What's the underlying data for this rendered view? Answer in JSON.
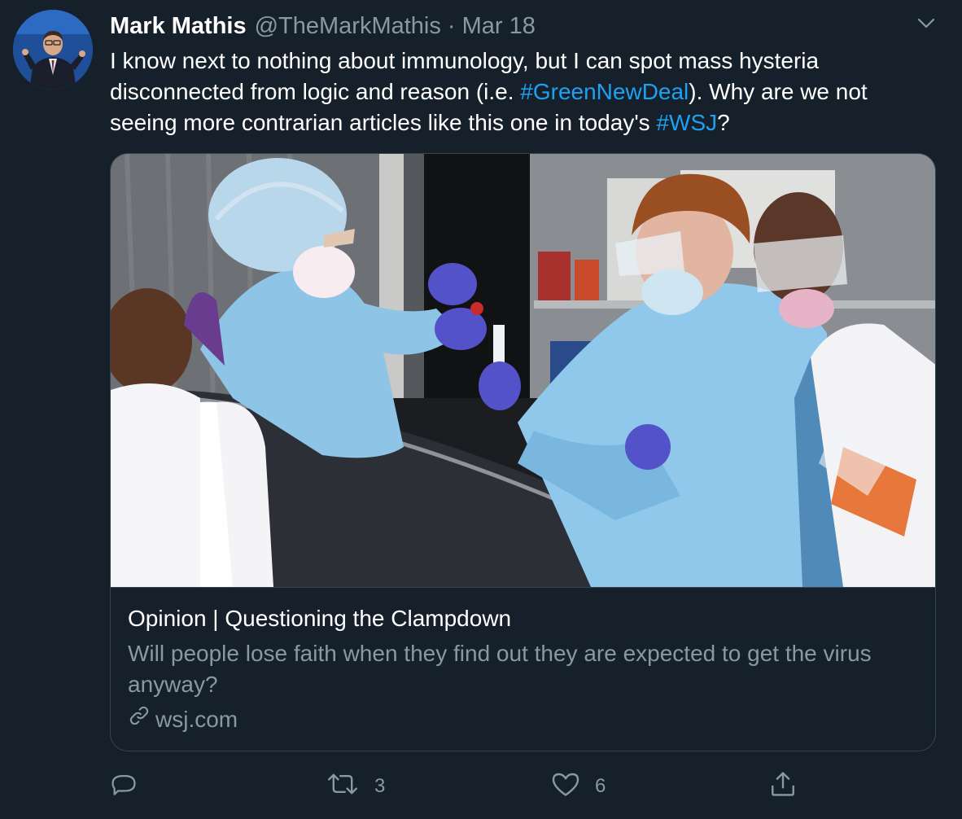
{
  "tweet": {
    "author_name": "Mark Mathis",
    "handle": "@TheMarkMathis",
    "separator": "·",
    "date": "Mar 18",
    "text": {
      "line1": "I know next to nothing about immunology, but I can spot mass hysteria",
      "line2_pre": "disconnected from logic and reason (i.e. ",
      "line2_tag": "#GreenNewDeal",
      "line2_post": "). Why are we not",
      "line3_pre": "seeing more contrarian articles like this one in today's ",
      "line3_tag": "#WSJ",
      "line3_post": "?"
    }
  },
  "card": {
    "title": "Opinion | Questioning the Clampdown",
    "description": "Will people lose faith when they find out they are expected to get the virus anyway?",
    "domain": "wsj.com"
  },
  "actions": {
    "reply_count": "",
    "retweet_count": "3",
    "like_count": "6"
  },
  "icons": {
    "caret": "chevron-down-icon",
    "reply": "reply-icon",
    "retweet": "retweet-icon",
    "like": "heart-icon",
    "share": "share-icon",
    "link": "link-icon"
  },
  "colors": {
    "background": "#15202b",
    "primary_text": "#ffffff",
    "secondary_text": "#8899a6",
    "hashtag": "#1da1f2",
    "border": "#38444d"
  }
}
